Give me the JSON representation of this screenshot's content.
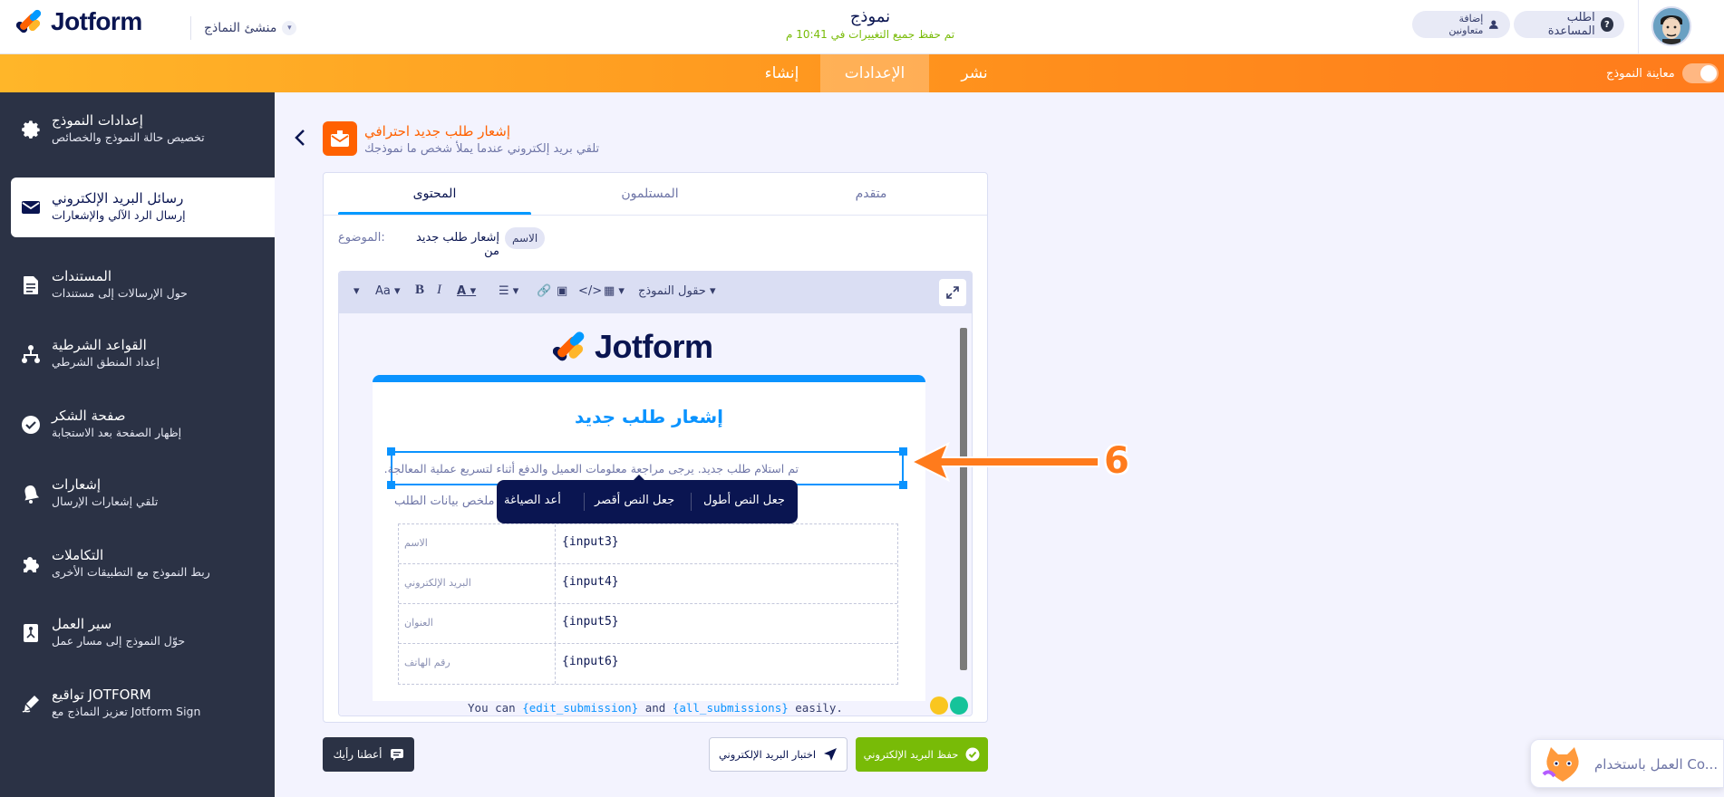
{
  "header": {
    "logo_text": "Jotform",
    "builder_label": "منشئ النماذج",
    "form_title": "نموذج",
    "save_status": "تم حفظ جميع التغييرات في 10:41 م",
    "help_label": "اطلب المساعدة",
    "add_collaborators_label": "إضافة متعاونين"
  },
  "nav": {
    "tabs": [
      {
        "label": "نشر"
      },
      {
        "label": "الإعدادات"
      },
      {
        "label": "إنشاء"
      }
    ],
    "preview_label": "معاينة النموذج"
  },
  "sidebar": {
    "items": [
      {
        "title": "إعدادات النموذج",
        "subtitle": "تخصيص حالة النموذج والخصائص",
        "icon": "gear-icon"
      },
      {
        "title": "رسائل البريد الإلكتروني",
        "subtitle": "إرسال الرد الآلي والإشعارات",
        "icon": "mail-icon"
      },
      {
        "title": "المستندات",
        "subtitle": "حول الإرسالات إلى مستندات",
        "icon": "document-icon"
      },
      {
        "title": "القواعد الشرطية",
        "subtitle": "إعداد المنطق الشرطي",
        "icon": "hierarchy-icon"
      },
      {
        "title": "صفحة الشكر",
        "subtitle": "إظهار الصفحة بعد الاستجابة",
        "icon": "check-circle-icon"
      },
      {
        "title": "إشعارات",
        "subtitle": "تلقي إشعارات الإرسال",
        "icon": "bell-icon"
      },
      {
        "title": "التكاملات",
        "subtitle": "ربط النموذج مع التطبيقات الأخرى",
        "icon": "puzzle-icon"
      },
      {
        "title": "سير العمل",
        "subtitle": "حوّل النموذج إلى مسار عمل",
        "icon": "workflow-icon"
      },
      {
        "title": "تواقيع JOTFORM",
        "subtitle": "تعزيز النماذج مع Jotform Sign",
        "icon": "signature-icon"
      }
    ]
  },
  "page": {
    "title": "إشعار طلب جديد احترافي",
    "subtitle": "تلقي بريد إلكتروني عندما يملأ شخص ما نموذجك"
  },
  "panel": {
    "tabs": [
      {
        "label": "متقدم"
      },
      {
        "label": "المستلمون"
      },
      {
        "label": "المحتوى"
      }
    ],
    "subject_label": ":الموضوع",
    "subject_text": "إشعار طلب جديد من",
    "subject_tag": "الاسم"
  },
  "toolbar": {
    "form_fields_label": "حقول النموذج",
    "font_size_label": "Aa",
    "bold": "B",
    "italic": "I",
    "color": "A"
  },
  "email": {
    "logo_text": "Jotform",
    "heading": "إشعار طلب جديد",
    "selected_text": "تم استلام طلب جديد. يرجى مراجعة معلومات العميل والدفع أثناء لتسريع عملية المعالجة.",
    "ai_actions": [
      "جعل النص أطول",
      "جعل النص أقصر",
      "أعد الصياغة"
    ],
    "summary_label": "ملخص بيانات الطلب",
    "rows": [
      {
        "label": "الاسم",
        "value": "{input3}"
      },
      {
        "label": "البريد الإلكتروني",
        "value": "{input4}"
      },
      {
        "label": "العنوان",
        "value": "{input5}"
      },
      {
        "label": "رقم الهاتف",
        "value": "{input6}"
      }
    ],
    "footnote_prefix": "You can ",
    "footnote_var1": "{edit_submission}",
    "footnote_mid": " and ",
    "footnote_var2": "{all_submissions}",
    "footnote_suffix": " easily."
  },
  "actions": {
    "feedback_label": "أعطنا رأيك",
    "test_label": "اختبار البريد الإلكتروني",
    "save_label": "حفظ البريد الإلكتروني"
  },
  "promo": {
    "text": "العمل باستخدام Co..."
  },
  "annotation": {
    "number": "6"
  },
  "colors": {
    "orange": "#ff6100",
    "blue": "#0a93ff",
    "navy": "#0a1551",
    "green": "#78bb07",
    "sidebar": "#2b3245"
  }
}
